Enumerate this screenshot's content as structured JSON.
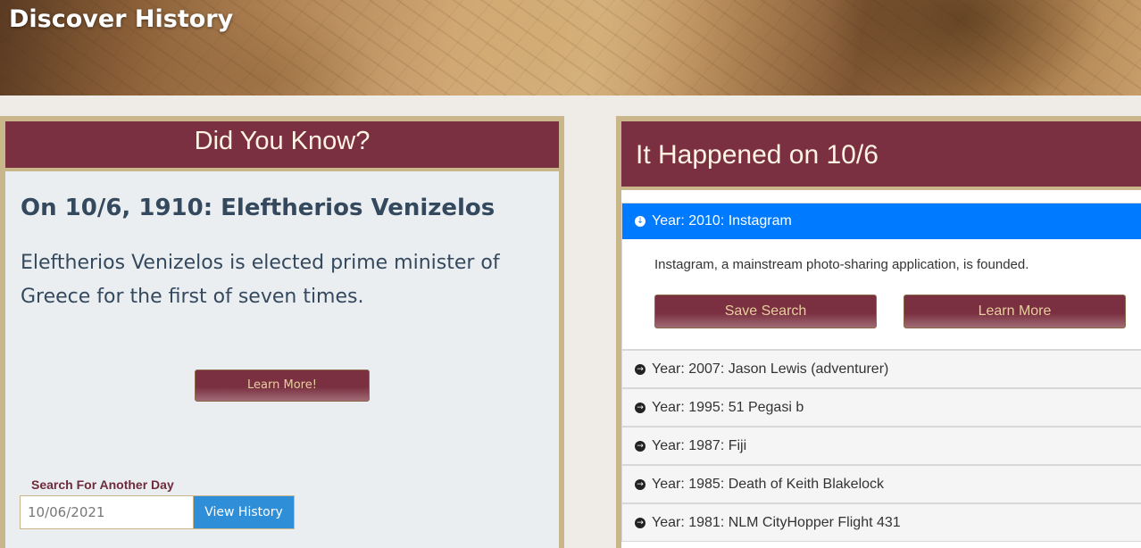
{
  "header": {
    "title": "Discover History"
  },
  "did_you_know": {
    "heading": "Did You Know?",
    "fact_title": "On 10/6, 1910: Eleftherios Venizelos",
    "fact_text": "Eleftherios Venizelos is elected prime minister of Greece for the first of seven times.",
    "learn_more_label": "Learn More!",
    "search_label": "Search For Another Day",
    "date_value": "10/06/2021",
    "view_history_label": "View History"
  },
  "happened": {
    "heading": "It Happened on 10/6",
    "active_item": {
      "label": "Year: 2010: Instagram",
      "description": "Instagram, a mainstream photo-sharing application, is founded.",
      "save_label": "Save Search",
      "learn_label": "Learn More"
    },
    "items": [
      {
        "label": "Year: 2007: Jason Lewis (adventurer)"
      },
      {
        "label": "Year: 1995: 51 Pegasi b"
      },
      {
        "label": "Year: 1987: Fiji"
      },
      {
        "label": "Year: 1985: Death of Keith Blakelock"
      },
      {
        "label": "Year: 1981: NLM CityHopper Flight 431"
      }
    ]
  },
  "colors": {
    "maroon": "#7a3040",
    "gold_border": "#c9b68a",
    "active_blue": "#007bff",
    "button_blue": "#2f8ed8"
  },
  "icons": {
    "expanded": "circle-arrow-down-icon",
    "collapsed": "circle-arrow-right-icon"
  }
}
